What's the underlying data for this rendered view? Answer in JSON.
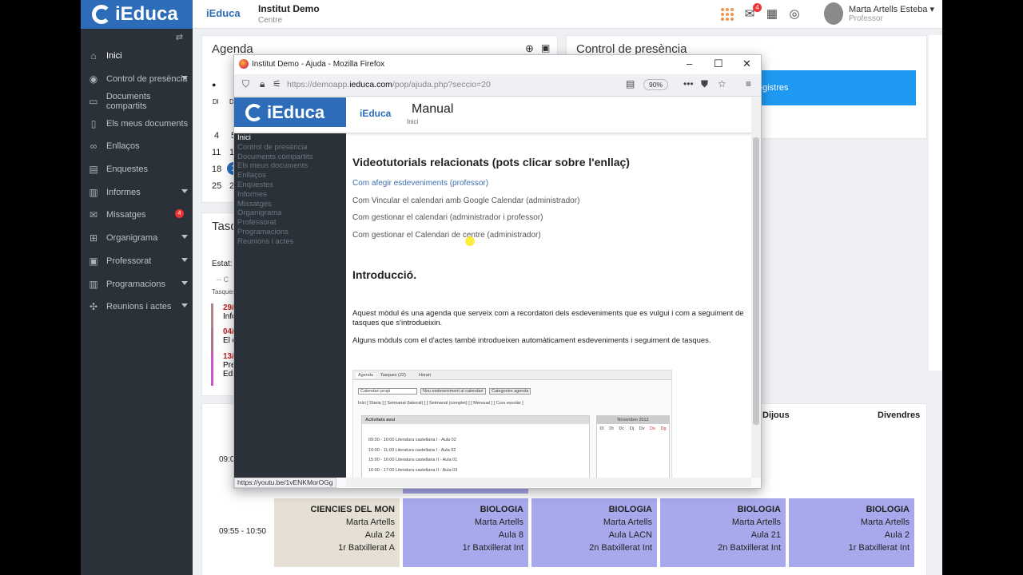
{
  "app": {
    "brand": "iEduca",
    "small_logo": "iEduca",
    "school_name": "Institut Demo",
    "school_sub": "Centre",
    "notification_count": "4",
    "user_name": "Marta Artells Esteba",
    "user_role": "Professor",
    "colors": {
      "brand_blue": "#2d6cb8",
      "sidebar": "#2b3138",
      "badge": "#e33333",
      "banner": "#1e9af2"
    }
  },
  "sidebar": {
    "items": [
      {
        "label": "Inici",
        "icon": "home-icon"
      },
      {
        "label": "Control de presència",
        "icon": "fingerprint-icon"
      },
      {
        "label": "Documents compartits",
        "icon": "folder-icon"
      },
      {
        "label": "Els meus documents",
        "icon": "document-icon"
      },
      {
        "label": "Enllaços",
        "icon": "link-icon"
      },
      {
        "label": "Enquestes",
        "icon": "survey-icon"
      },
      {
        "label": "Informes",
        "icon": "report-icon"
      },
      {
        "label": "Missatges",
        "icon": "mail-icon",
        "badge": "4"
      },
      {
        "label": "Organigrama",
        "icon": "org-chart-icon"
      },
      {
        "label": "Professorat",
        "icon": "teacher-icon"
      },
      {
        "label": "Programacions",
        "icon": "book-icon"
      },
      {
        "label": "Reunions i actes",
        "icon": "meeting-icon"
      }
    ]
  },
  "agenda": {
    "title": "Agenda",
    "weekday_head": [
      "Dl",
      "Dt"
    ],
    "rows": [
      [
        "4",
        "5"
      ],
      [
        "11",
        "1"
      ],
      [
        "18",
        "1"
      ],
      [
        "25",
        "2"
      ]
    ]
  },
  "presence": {
    "title": "Control de presència",
    "banner": "egistres"
  },
  "tasks": {
    "title": "Tasq",
    "state_label": "Estat:",
    "filter": "-- C",
    "sub": "Tasques",
    "items": [
      {
        "date": "29/",
        "text": "Info"
      },
      {
        "date": "04/",
        "text": "El d"
      },
      {
        "date": "13/",
        "text": "Pre",
        "text2": "Edi"
      }
    ]
  },
  "schedule": {
    "days": [
      "Dijous",
      "Divendres"
    ],
    "slots": [
      "09:0",
      "09:55 - 10:50"
    ],
    "cells": [
      {
        "subject": "CIENCIES DEL MON",
        "teacher": "Marta Artells",
        "room": "Aula 24",
        "group": "1r Batxillerat A"
      },
      {
        "subject": "BIOLOGIA",
        "teacher": "Marta Artells",
        "room": "Aula 8",
        "group": "1r Batxillerat Int"
      },
      {
        "subject": "BIOLOGIA",
        "teacher": "Marta Artells",
        "room": "Aula LACN",
        "group": "2n Batxillerat Int"
      },
      {
        "subject": "BIOLOGIA",
        "teacher": "Marta Artells",
        "room": "Aula 21",
        "group": "2n Batxillerat Int"
      },
      {
        "subject": "BIOLOGIA",
        "teacher": "Marta Artells",
        "room": "Aula 2",
        "group": "1r Batxillerat Int"
      }
    ]
  },
  "firefox": {
    "window_title": "Institut Demo - Ajuda - Mozilla Firefox",
    "url_prefix": "https://demoapp.",
    "url_host": "ieduca.com",
    "url_rest": "/pop/ajuda.php?seccio=20",
    "zoom": "90%",
    "status_url": "https://youtu.be/1vENKMorOGg"
  },
  "help": {
    "brand": "iEduca",
    "small_logo": "iEduca",
    "title": "Manual",
    "breadcrumb": "Inici",
    "side_items": [
      "Inici",
      "Control de presència",
      "Documents compartits",
      "Els meus documents",
      "Enllaços",
      "Enquestes",
      "Informes",
      "Missatges",
      "Organigrama",
      "Professorat",
      "Programacions",
      "Reunions i actes"
    ],
    "video_heading": "Videotutorials relacionats (pots clicar sobre l'enllaç)",
    "links": [
      "Com afegir esdeveniments (professor)",
      "Com Vincular el calendari amb Google Calendar (administrador)",
      "Com gestionar el calendari (administrador i professor)",
      "Com gestionar el Calendari de centre (administrador)"
    ],
    "intro_heading": "Introducció.",
    "para1": "Aquest mòdul és una agenda que serveix com a recordatori dels esdeveniments que es vulgui i com a seguiment de tasques que s'introdueixin.",
    "para2": "Alguns mòduls com el d'actes també introdueixen automàticament esdeveniments i seguiment de tasques.",
    "shot": {
      "tabs": [
        "Agenda",
        "Tasques (22)",
        "Horari"
      ],
      "select": "Calendari propi",
      "btn_new": "Nou esdeveniment al calendari",
      "btn_cat": "Categories agenda",
      "views": "Inici [ Diaria ] [ Setmanal (laboral) ] [ Setmanal (complet) ] [ Mensual ] [ Curs escolar ]",
      "activities_title": "Activitats avui",
      "activities": [
        "09:00 - 10:00 Literatura castellana I - Aula 02",
        "10:00 - 11:00 Literatura castellana I - Aula 02",
        "15:00 - 16:00 Literatura castellana II - Aula 01",
        "16:00 - 17:00 Literatura castellana II - Aula 03"
      ],
      "month": "Novembre 2012",
      "wd": [
        "Dl",
        "Dt",
        "Dc",
        "Dj",
        "Dv",
        "Ds",
        "Dg"
      ]
    }
  }
}
